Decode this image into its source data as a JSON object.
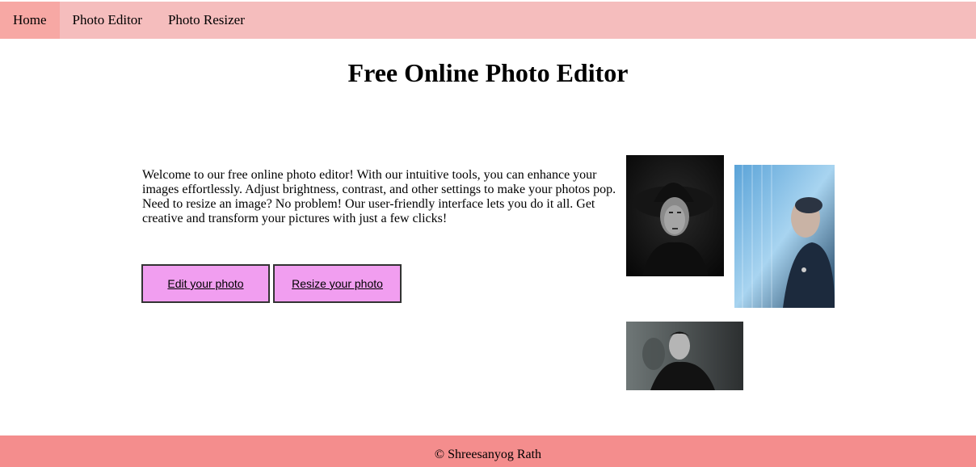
{
  "nav": {
    "items": [
      {
        "label": "Home"
      },
      {
        "label": "Photo Editor"
      },
      {
        "label": "Photo Resizer"
      }
    ]
  },
  "main": {
    "title": "Free Online Photo Editor",
    "intro": "Welcome to our free online photo editor! With our intuitive tools, you can enhance your images effortlessly. Adjust brightness, contrast, and other settings to make your photos pop. Need to resize an image? No problem! Our user-friendly interface lets you do it all. Get creative and transform your pictures with just a few clicks!",
    "buttons": {
      "edit_label": "Edit your photo",
      "resize_label": "Resize your photo"
    }
  },
  "footer": {
    "text": "© Shreesanyog Rath"
  },
  "colors": {
    "nav_bg": "#f5bdbd",
    "nav_active": "#f7a8a4",
    "button_bg": "#f19ef0",
    "footer_bg": "#f48d8d"
  }
}
